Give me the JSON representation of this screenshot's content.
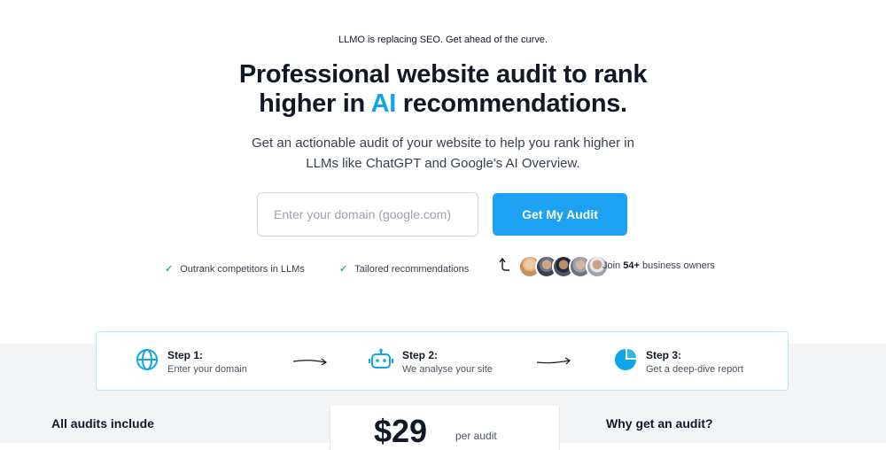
{
  "hero": {
    "eyebrow": "LLMO is replacing SEO. Get ahead of the curve.",
    "headline_line1": "Professional website audit to rank",
    "headline_line2_pre": "higher in ",
    "headline_accent": "AI",
    "headline_line2_post": " recommendations.",
    "subtitle_line1": "Get an actionable audit of your website to help you rank higher in",
    "subtitle_line2": "LLMs like ChatGPT and Google's AI Overview."
  },
  "form": {
    "domain_placeholder": "Enter your domain (google.com)",
    "domain_value": "",
    "submit_label": "Get My Audit"
  },
  "benefits": [
    {
      "label": "Outrank competitors in LLMs",
      "icon": "check-icon"
    },
    {
      "label": "Tailored recommendations",
      "icon": "check-icon"
    }
  ],
  "social_proof": {
    "prefix": "Join ",
    "count": "54+",
    "suffix": " business owners",
    "avatar_count": 5
  },
  "steps": [
    {
      "title": "Step 1:",
      "description": "Enter your domain",
      "icon": "globe-icon"
    },
    {
      "title": "Step 2:",
      "description": "We analyse your site",
      "icon": "robot-icon"
    },
    {
      "title": "Step 3:",
      "description": "Get a deep-dive report",
      "icon": "pie-chart-icon"
    }
  ],
  "pricing": {
    "includes_heading": "All audits include",
    "price": "$29",
    "price_unit": "per audit",
    "why_heading": "Why get an audit?"
  },
  "colors": {
    "accent": "#0ea5e9",
    "cta": "#1da1f2",
    "check": "#22c55e",
    "section_bg": "#f3f4f6"
  }
}
